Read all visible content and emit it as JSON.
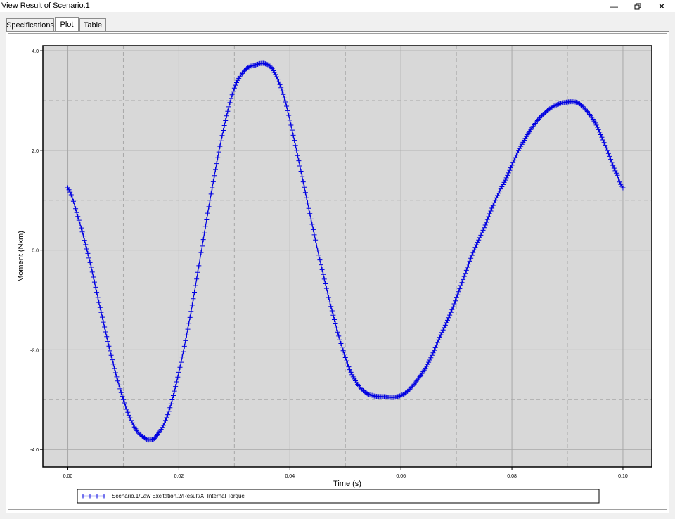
{
  "window": {
    "title": "View Result of Scenario.1",
    "minimize_icon": "minimize-icon",
    "restore_icon": "restore-icon",
    "close_icon": "close-icon"
  },
  "tabs": [
    {
      "label": "Specifications",
      "active": false
    },
    {
      "label": "Plot",
      "active": true
    },
    {
      "label": "Table",
      "active": false
    }
  ],
  "colors": {
    "series": "#0000e0",
    "plot_background": "#d8d8d8"
  },
  "chart_data": {
    "type": "line",
    "xlabel": "Time (s)",
    "ylabel": "Moment (Nxm)",
    "xlim": [
      -0.0045,
      0.1052
    ],
    "ylim": [
      -4.35,
      4.1
    ],
    "xticks": [
      "0.00",
      "0.02",
      "0.04",
      "0.06",
      "0.08",
      "0.10"
    ],
    "yticks": [
      "4.0",
      "2.0",
      "0.0",
      "-2.0",
      "-4.0"
    ],
    "grid": true,
    "legend_position": "bottom",
    "marker": "plus",
    "series": [
      {
        "name": "Scenario.1/Law Excitation.2/Result/X_Internal Torque",
        "x": [
          0.0,
          0.002,
          0.004,
          0.006,
          0.008,
          0.01,
          0.012,
          0.014,
          0.015,
          0.016,
          0.018,
          0.02,
          0.022,
          0.024,
          0.026,
          0.028,
          0.03,
          0.032,
          0.034,
          0.0355,
          0.037,
          0.039,
          0.041,
          0.043,
          0.045,
          0.047,
          0.049,
          0.051,
          0.053,
          0.055,
          0.057,
          0.059,
          0.061,
          0.063,
          0.065,
          0.067,
          0.069,
          0.071,
          0.073,
          0.075,
          0.077,
          0.079,
          0.081,
          0.083,
          0.085,
          0.087,
          0.089,
          0.0915,
          0.093,
          0.095,
          0.097,
          0.099,
          0.1
        ],
        "y": [
          1.25,
          0.6,
          -0.25,
          -1.25,
          -2.2,
          -3.0,
          -3.55,
          -3.78,
          -3.8,
          -3.72,
          -3.3,
          -2.45,
          -1.35,
          -0.05,
          1.25,
          2.4,
          3.25,
          3.62,
          3.72,
          3.74,
          3.6,
          3.05,
          2.1,
          1.05,
          0.0,
          -0.95,
          -1.8,
          -2.45,
          -2.8,
          -2.92,
          -2.94,
          -2.95,
          -2.85,
          -2.6,
          -2.25,
          -1.75,
          -1.25,
          -0.65,
          -0.05,
          0.45,
          1.0,
          1.45,
          1.95,
          2.35,
          2.65,
          2.85,
          2.95,
          2.97,
          2.85,
          2.55,
          2.05,
          1.5,
          1.25
        ]
      }
    ]
  }
}
